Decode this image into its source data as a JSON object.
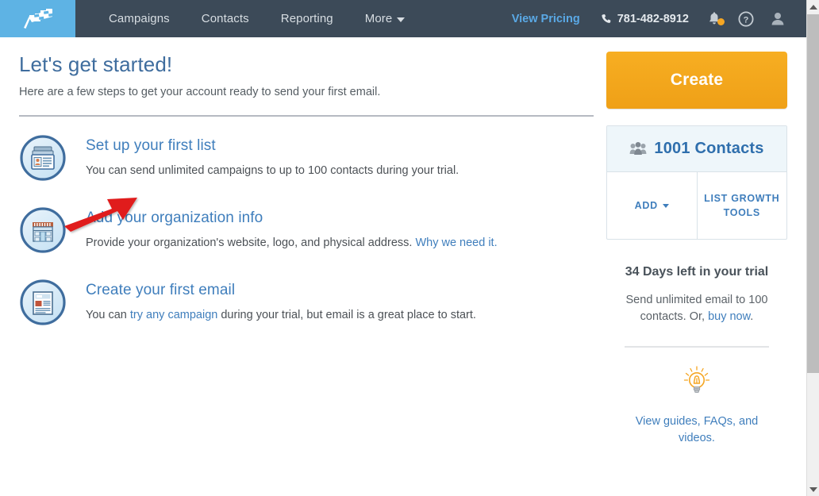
{
  "navbar": {
    "logo_icon": "checkered-flag-logo",
    "links": [
      {
        "label": "Campaigns"
      },
      {
        "label": "Contacts"
      },
      {
        "label": "Reporting"
      },
      {
        "label": "More"
      }
    ],
    "pricing_label": "View Pricing",
    "phone": "781-482-8912",
    "phone_icon": "phone-icon",
    "bell_icon": "bell-notification-icon",
    "help_icon": "question-circle-icon",
    "account_icon": "user-avatar-icon"
  },
  "main": {
    "title": "Let's get started!",
    "subtitle": "Here are a few steps to get your account ready to send your first email.",
    "steps": [
      {
        "icon": "contact-list-icon",
        "title": "Set up your first list",
        "desc_before": "You can send unlimited campaigns to up to 100 contacts during your trial.",
        "link_text": "",
        "desc_after": ""
      },
      {
        "icon": "storefront-icon",
        "title": "Add your organization info",
        "desc_before": "Provide your organization's website, logo, and physical address. ",
        "link_text": "Why we need it.",
        "desc_after": ""
      },
      {
        "icon": "newsletter-icon",
        "title": "Create your first email",
        "desc_before": "You can ",
        "link_text": "try any campaign",
        "desc_after": " during your trial, but email is a great place to start."
      }
    ],
    "annotation": {
      "type": "red-arrow",
      "color": "#e01b1b",
      "points_to": "Set up your first list"
    }
  },
  "sidebar": {
    "create_label": "Create",
    "contacts": {
      "icon": "people-group-icon",
      "count_label": "1001 Contacts",
      "add_label": "ADD",
      "list_growth_label": "LIST GROWTH TOOLS"
    },
    "trial": {
      "title": "34 Days left in your trial",
      "desc_before": "Send unlimited email to 100 contacts. Or, ",
      "link_text": "buy now",
      "desc_after": "."
    },
    "guides": {
      "icon": "lightbulb-icon",
      "link_text": "View guides, FAQs, and videos."
    }
  },
  "scrollbar": {
    "up_icon": "scroll-up-arrow",
    "down_icon": "scroll-down-arrow"
  },
  "colors": {
    "navbar_bg": "#3c4a58",
    "logo_bg": "#5eb3e4",
    "accent_orange": "#f5a41b",
    "link_blue": "#3f7ebc",
    "title_blue": "#3f6d9e",
    "annotation_red": "#e01b1b"
  }
}
